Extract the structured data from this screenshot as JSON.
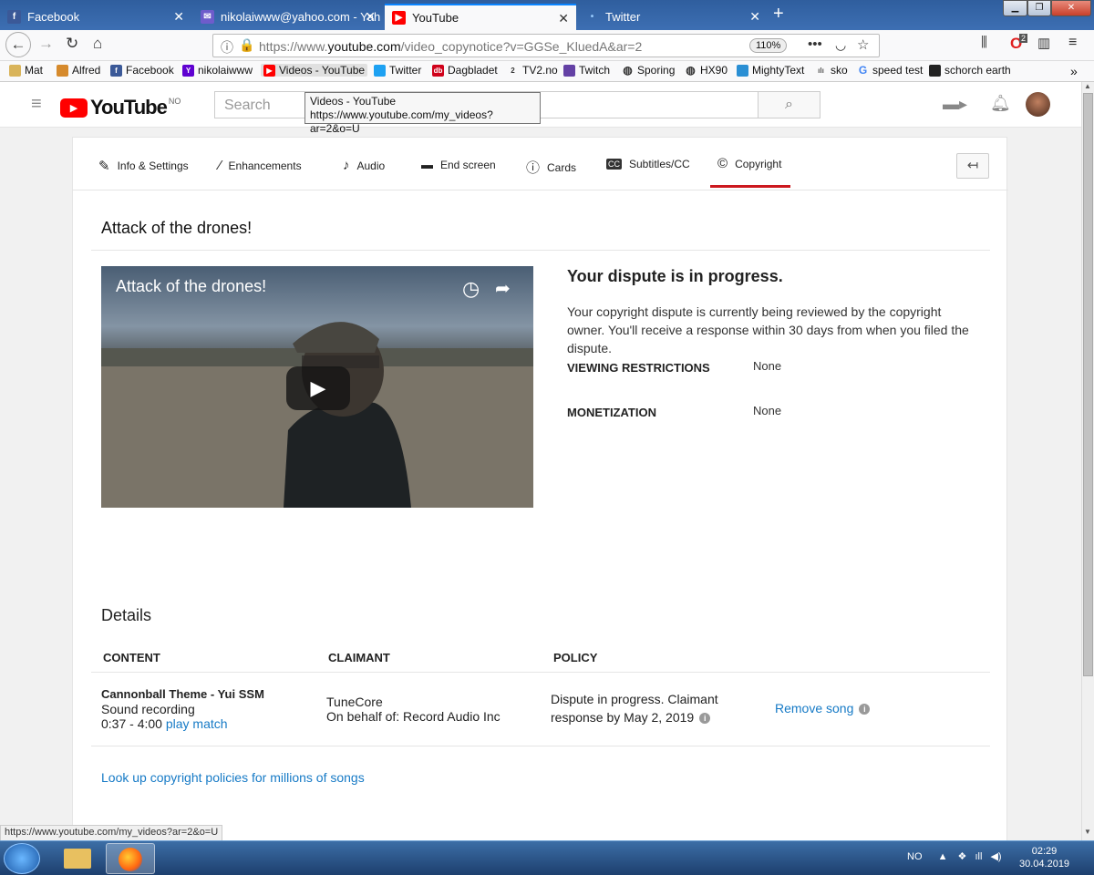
{
  "browser": {
    "tabs": [
      {
        "label": "Facebook",
        "icon": "facebook-icon"
      },
      {
        "label": "nikolaiwww@yahoo.com - Yah",
        "icon": "mail-icon"
      },
      {
        "label": "YouTube",
        "icon": "youtube-icon",
        "active": true
      },
      {
        "label": "Twitter",
        "icon": "twitter-icon"
      }
    ],
    "url_prefix": "https://www.",
    "url_domain": "youtube.com",
    "url_path": "/video_copynotice?v=GGSe_KluedA&ar=2",
    "zoom": "110%",
    "bookmarks": [
      {
        "label": "Mat",
        "icon": "folder-icon"
      },
      {
        "label": "Alfred",
        "icon": "alfred-icon"
      },
      {
        "label": "Facebook",
        "icon": "facebook-icon"
      },
      {
        "label": "nikolaiwww",
        "icon": "yahoo-icon"
      },
      {
        "label": "Videos - YouTube",
        "icon": "youtube-icon"
      },
      {
        "label": "Twitter",
        "icon": "twitter-icon"
      },
      {
        "label": "Dagbladet",
        "icon": "dagbladet-icon"
      },
      {
        "label": "TV2.no",
        "icon": "tv2-icon"
      },
      {
        "label": "Twitch",
        "icon": "twitch-icon"
      },
      {
        "label": "Sporing",
        "icon": "globe-icon"
      },
      {
        "label": "HX90",
        "icon": "globe-icon"
      },
      {
        "label": "MightyText",
        "icon": "mightytext-icon"
      },
      {
        "label": "sko",
        "icon": "sko-icon"
      },
      {
        "label": "speed test",
        "icon": "google-icon"
      },
      {
        "label": "schorch earth",
        "icon": "schorch-icon"
      }
    ],
    "tooltip": {
      "title": "Videos - YouTube",
      "url": "https://www.youtube.com/my_videos?ar=2&o=U"
    },
    "status_url": "https://www.youtube.com/my_videos?ar=2&o=U",
    "notification_count": "2"
  },
  "youtube": {
    "logo": "YouTube",
    "country": "NO",
    "search_placeholder": "Search"
  },
  "editor_tabs": [
    {
      "label": "Info & Settings",
      "icon": "pencil-icon"
    },
    {
      "label": "Enhancements",
      "icon": "magic-wand-icon"
    },
    {
      "label": "Audio",
      "icon": "music-note-icon"
    },
    {
      "label": "End screen",
      "icon": "end-screen-icon"
    },
    {
      "label": "Cards",
      "icon": "info-icon"
    },
    {
      "label": "Subtitles/CC",
      "icon": "cc-icon"
    },
    {
      "label": "Copyright",
      "icon": "copyright-icon",
      "active": true
    }
  ],
  "video": {
    "title": "Attack of the drones!"
  },
  "dispute": {
    "heading": "Your dispute is in progress.",
    "text": "Your copyright dispute is currently being reviewed by the copyright owner. You'll receive a response within 30 days from when you filed the dispute.",
    "viewing_label": "VIEWING RESTRICTIONS",
    "viewing_value": "None",
    "monetization_label": "MONETIZATION",
    "monetization_value": "None"
  },
  "details": {
    "heading": "Details",
    "columns": [
      "CONTENT",
      "CLAIMANT",
      "POLICY"
    ],
    "row": {
      "content_title": "Cannonball Theme - Yui SSM",
      "content_type": "Sound recording",
      "content_time": "0:37 - 4:00",
      "play_match": "play match",
      "claimant_name": "TuneCore",
      "claimant_behalf": "On behalf of: Record Audio Inc",
      "policy_line1": "Dispute in progress. Claimant",
      "policy_line2": "response by May 2, 2019",
      "action": "Remove song"
    },
    "lookup_link": "Look up copyright policies for millions of songs"
  },
  "taskbar": {
    "language": "NO",
    "time": "02:29",
    "date": "30.04.2019"
  },
  "colors": {
    "youtube_red": "#ff0000",
    "link_blue": "#167ac6",
    "tab_accent": "#cc181e"
  }
}
